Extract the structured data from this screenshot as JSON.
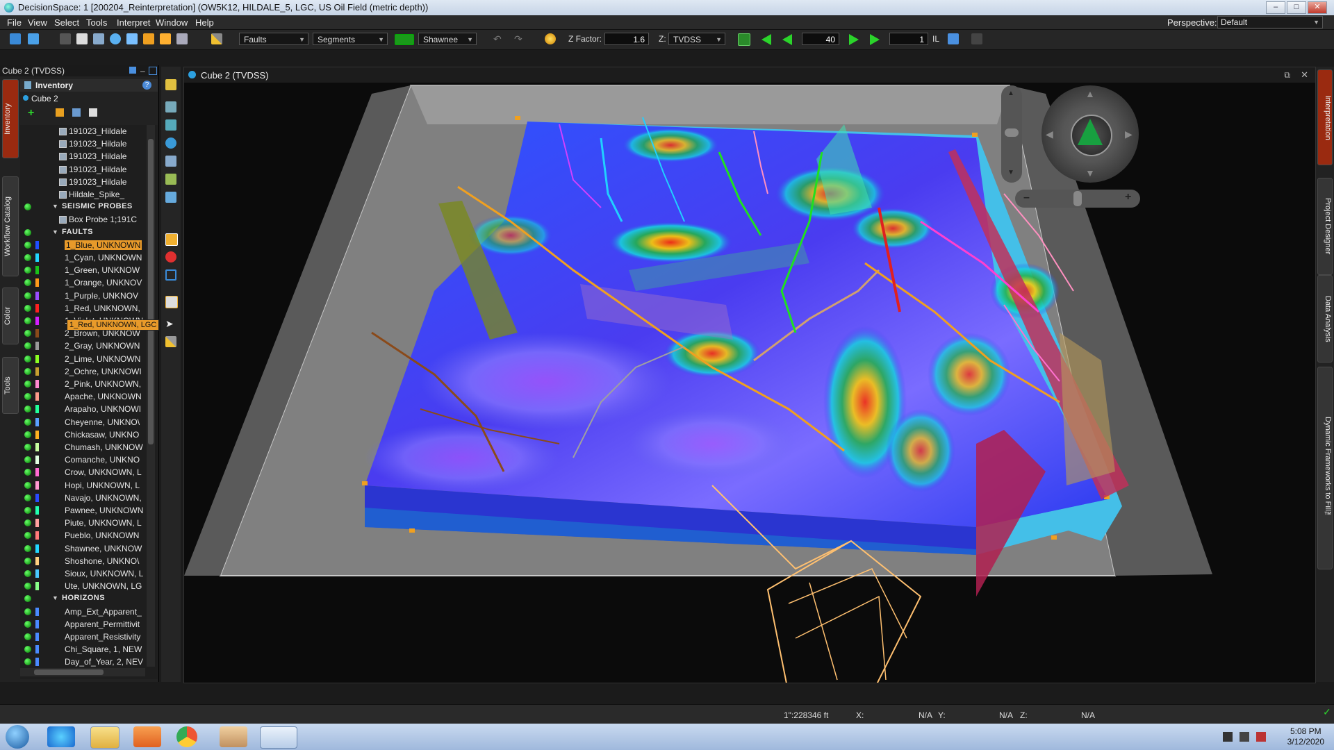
{
  "window": {
    "title": "DecisionSpace: 1 [200204_Reinterpretation] (OW5K12, HILDALE_5, LGC, US Oil Field (metric depth))"
  },
  "menu": [
    "File",
    "View",
    "Select",
    "Tools",
    "Interpret",
    "Window",
    "Help"
  ],
  "perspective": {
    "label": "Perspective:",
    "value": "Default"
  },
  "toolbar": {
    "mode": "Faults",
    "submode": "Segments",
    "fault_name": "Shawnee",
    "zfactor_label": "Z Factor:",
    "zfactor": "1.6",
    "z_label": "Z:",
    "z_domain": "TVDSS",
    "step": "40",
    "index": "1",
    "il_label": "IL"
  },
  "left_panel": {
    "header": "Cube 2 (TVDSS)",
    "inventory_title": "Inventory",
    "cube_name": "Cube 2",
    "side_tabs": [
      "Inventory",
      "Workflow Catalog",
      "Color",
      "Tools"
    ],
    "items": [
      {
        "label": "191023_Hildale",
        "kind": "file"
      },
      {
        "label": "191023_Hildale",
        "kind": "file"
      },
      {
        "label": "191023_Hildale",
        "kind": "file"
      },
      {
        "label": "191023_Hildale",
        "kind": "file"
      },
      {
        "label": "191023_Hildale",
        "kind": "file"
      },
      {
        "label": "Hildale_Spike_",
        "kind": "file"
      },
      {
        "label": "Seismic Probes",
        "kind": "group"
      },
      {
        "label": "Box Probe 1;191C",
        "kind": "probe"
      },
      {
        "label": "Faults",
        "kind": "group"
      },
      {
        "label": "1_Blue, UNKNOWN",
        "kind": "item",
        "color": "#1f4fff",
        "selected": true
      },
      {
        "label": "1_Cyan, UNKNOWN",
        "kind": "item",
        "color": "#22d6ff"
      },
      {
        "label": "1_Green, UNKNOW",
        "kind": "item",
        "color": "#19c219"
      },
      {
        "label": "1_Orange, UNKNOV",
        "kind": "item",
        "color": "#ff9a1a"
      },
      {
        "label": "1_Purple, UNKNOV",
        "kind": "item",
        "color": "#9a4dff"
      },
      {
        "label": "1_Red, UNKNOWN,",
        "kind": "item",
        "color": "#ff2020"
      },
      {
        "label": "1_Violet, UNKNOWN",
        "kind": "item",
        "color": "#d21fff"
      },
      {
        "label": "2_Brown, UNKNOW",
        "kind": "item",
        "color": "#8a4a1a"
      },
      {
        "label": "2_Gray, UNKNOWN",
        "kind": "item",
        "color": "#9a9a9a"
      },
      {
        "label": "2_Lime, UNKNOWN",
        "kind": "item",
        "color": "#8cff22"
      },
      {
        "label": "2_Ochre, UNKNOWI",
        "kind": "item",
        "color": "#c8a030"
      },
      {
        "label": "2_Pink, UNKNOWN,",
        "kind": "item",
        "color": "#ff8ad0"
      },
      {
        "label": "Apache, UNKNOWN",
        "kind": "item",
        "color": "#ff9a8a"
      },
      {
        "label": "Arapaho, UNKNOWI",
        "kind": "item",
        "color": "#22ff9a"
      },
      {
        "label": "Cheyenne, UNKNO\\",
        "kind": "item",
        "color": "#5aa0ff"
      },
      {
        "label": "Chickasaw, UNKNO",
        "kind": "item",
        "color": "#ffb020"
      },
      {
        "label": "Chumash, UNKNOW",
        "kind": "item",
        "color": "#c8ffa0"
      },
      {
        "label": "Comanche, UNKNO",
        "kind": "item",
        "color": "#e0ffe0"
      },
      {
        "label": "Crow, UNKNOWN, L",
        "kind": "item",
        "color": "#ff6ad2"
      },
      {
        "label": "Hopi, UNKNOWN, L",
        "kind": "item",
        "color": "#ff9ad2"
      },
      {
        "label": "Navajo, UNKNOWN,",
        "kind": "item",
        "color": "#2a4aff"
      },
      {
        "label": "Pawnee, UNKNOWN",
        "kind": "item",
        "color": "#22ffb0"
      },
      {
        "label": "Piute, UNKNOWN, L",
        "kind": "item",
        "color": "#ffa0a0"
      },
      {
        "label": "Pueblo, UNKNOWN",
        "kind": "item",
        "color": "#ff7a7a"
      },
      {
        "label": "Shawnee, UNKNOW",
        "kind": "item",
        "color": "#22d6ff"
      },
      {
        "label": "Shoshone, UNKNO\\",
        "kind": "item",
        "color": "#ffd080"
      },
      {
        "label": "Sioux, UNKNOWN, L",
        "kind": "item",
        "color": "#4ac8ff"
      },
      {
        "label": "Ute, UNKNOWN, LG",
        "kind": "item",
        "color": "#8aff8a"
      },
      {
        "label": "Horizons",
        "kind": "group"
      },
      {
        "label": "Amp_Ext_Apparent_",
        "kind": "item",
        "color": "#4a8aff"
      },
      {
        "label": "Apparent_Permittivit",
        "kind": "item",
        "color": "#4a8aff"
      },
      {
        "label": "Apparent_Resistivity",
        "kind": "item",
        "color": "#4a8aff"
      },
      {
        "label": "Chi_Square, 1, NEW",
        "kind": "item",
        "color": "#4a8aff"
      },
      {
        "label": "Day_of_Year, 2, NEV",
        "kind": "item",
        "color": "#4a8aff"
      }
    ],
    "tooltip": "1_Red, UNKNOWN, LGC"
  },
  "viewport": {
    "title": "Cube 2 (TVDSS)"
  },
  "right_tabs": [
    "Interpretation",
    "Project Designer",
    "Data Analysis",
    "Dynamic Frameworks to Fill™"
  ],
  "status": {
    "scale": "1\":228346 ft",
    "x_label": "X:",
    "x_value": "N/A",
    "y_label": "Y:",
    "y_value": "N/A",
    "z_label": "Z:",
    "z_value": "N/A"
  },
  "taskbar": {
    "time": "5:08 PM",
    "date": "3/12/2020"
  }
}
